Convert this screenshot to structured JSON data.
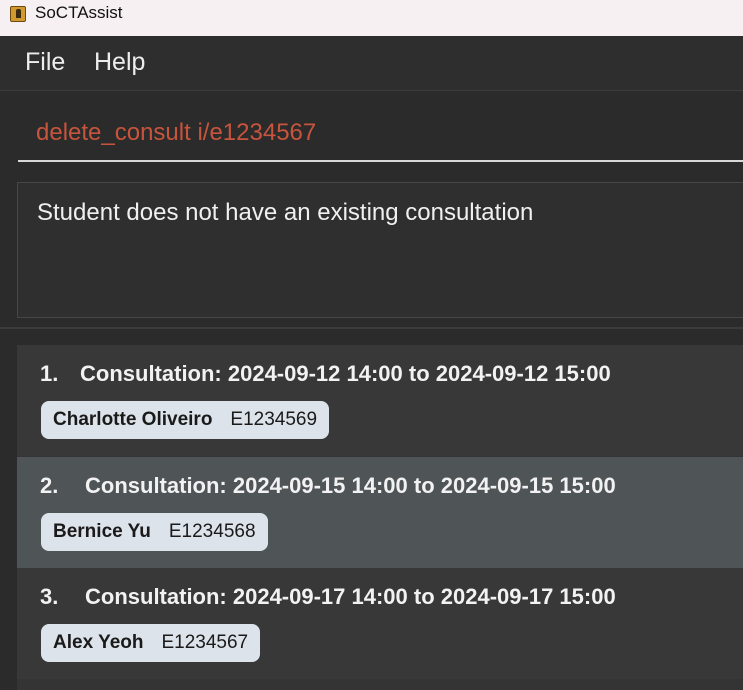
{
  "window": {
    "title": "SoCTAssist",
    "icon": "app-icon"
  },
  "menu": {
    "file": "File",
    "help": "Help"
  },
  "command": {
    "value": "delete_consult i/e1234567",
    "color": "#c7543c"
  },
  "result": {
    "message": "Student does not have an existing consultation"
  },
  "consultations": [
    {
      "index": "1.",
      "title": "Consultation: 2024-09-12 14:00 to 2024-09-12 15:00",
      "student_name": "Charlotte Oliveiro",
      "student_id": "E1234569",
      "selected": false
    },
    {
      "index": "2.",
      "title": "Consultation: 2024-09-15 14:00 to 2024-09-15 15:00",
      "student_name": "Bernice Yu",
      "student_id": "E1234568",
      "selected": true
    },
    {
      "index": "3.",
      "title": "Consultation: 2024-09-17 14:00 to 2024-09-17 15:00",
      "student_name": "Alex Yeoh",
      "student_id": "E1234567",
      "selected": false
    }
  ],
  "colors": {
    "selected_row": "#4f5456",
    "tag_background": "#dde3ea"
  }
}
